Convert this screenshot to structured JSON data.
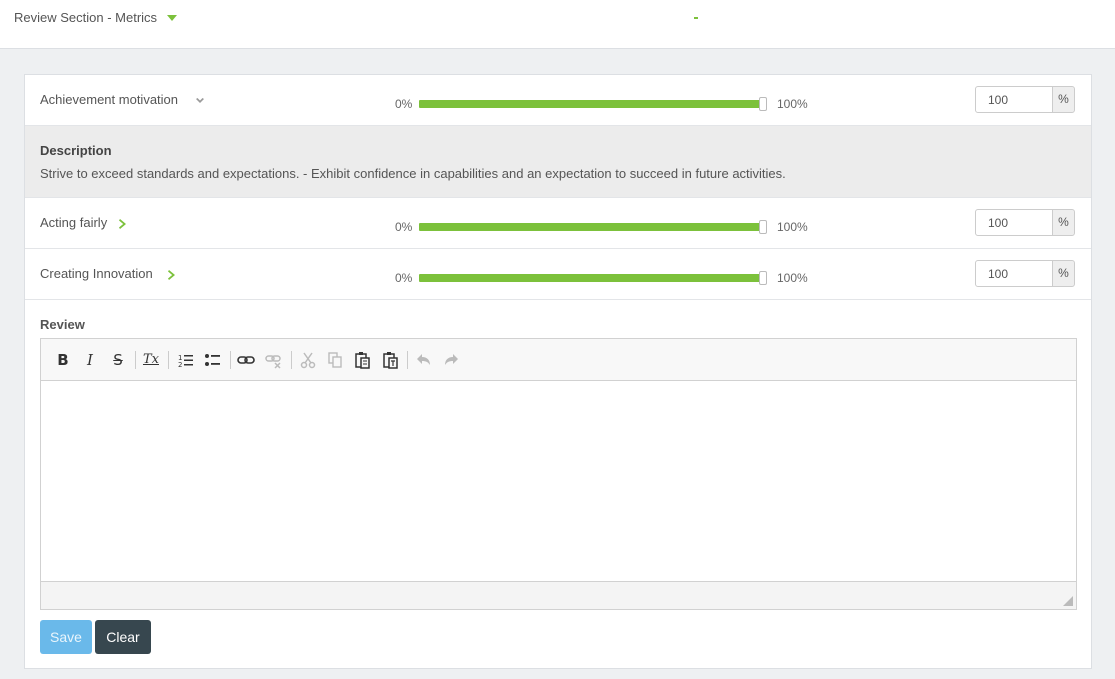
{
  "header": {
    "section_title": "Review Section - Metrics",
    "center_mark": "-",
    "accent": "#7cc13b"
  },
  "metrics": [
    {
      "name": "Achievement motivation",
      "expanded": true,
      "slider_min_label": "0%",
      "slider_max_label": "100%",
      "value": "100",
      "fill_fraction": 1.0,
      "unit": "%",
      "description_title": "Description",
      "description": "Strive to exceed standards and expectations. - Exhibit confidence in capabilities and an expectation to succeed in future activities."
    },
    {
      "name": "Acting fairly",
      "expanded": false,
      "slider_min_label": "0%",
      "slider_max_label": "100%",
      "value": "100",
      "fill_fraction": 1.0,
      "unit": "%"
    },
    {
      "name": "Creating Innovation",
      "expanded": false,
      "slider_min_label": "0%",
      "slider_max_label": "100%",
      "value": "100",
      "fill_fraction": 1.0,
      "unit": "%"
    }
  ],
  "review": {
    "label": "Review",
    "toolbar": {
      "bold": "B",
      "italic": "I",
      "strike": "S",
      "remove_format": "Tx",
      "icons": [
        "bold-icon",
        "italic-icon",
        "strikethrough-icon",
        "remove-format-icon",
        "numbered-list-icon",
        "bulleted-list-icon",
        "link-icon",
        "unlink-icon",
        "cut-icon",
        "copy-icon",
        "paste-icon",
        "paste-text-icon",
        "undo-icon",
        "redo-icon"
      ]
    },
    "content": ""
  },
  "buttons": {
    "save": "Save",
    "clear": "Clear",
    "save_color": "#6ab9ea",
    "clear_color": "#37474f"
  }
}
